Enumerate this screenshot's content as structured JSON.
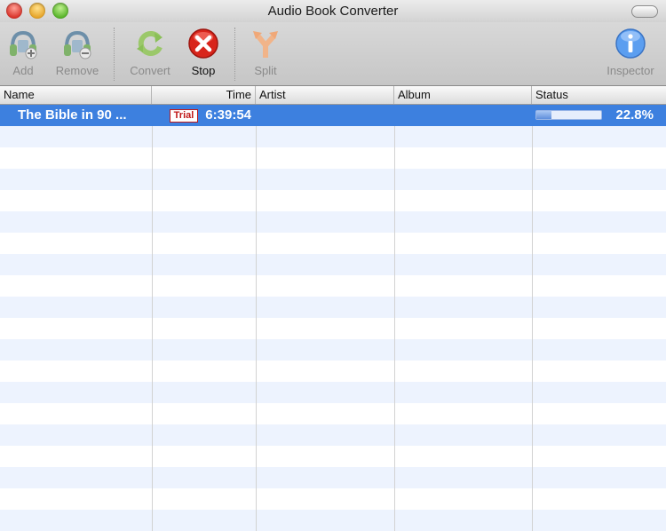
{
  "window": {
    "title": "Audio Book Converter"
  },
  "toolbar": {
    "add_label": "Add",
    "remove_label": "Remove",
    "convert_label": "Convert",
    "stop_label": "Stop",
    "split_label": "Split",
    "inspector_label": "Inspector",
    "icons": {
      "add": "headphones-add-icon",
      "remove": "headphones-remove-icon",
      "convert": "convert-arrows-icon",
      "stop": "stop-x-icon",
      "split": "split-arrows-icon",
      "inspector": "info-icon"
    }
  },
  "table": {
    "columns": [
      "Name",
      "Time",
      "Artist",
      "Album",
      "Status"
    ],
    "rows": [
      {
        "name": "The Bible in 90 ...",
        "badge": "Trial",
        "time": "6:39:54",
        "artist": "",
        "album": "",
        "progress": 0.228,
        "status": "22.8%"
      }
    ]
  },
  "colors": {
    "selection": "#3d80df",
    "stripe": "#edf3fe",
    "trial_badge": "#c01818"
  }
}
